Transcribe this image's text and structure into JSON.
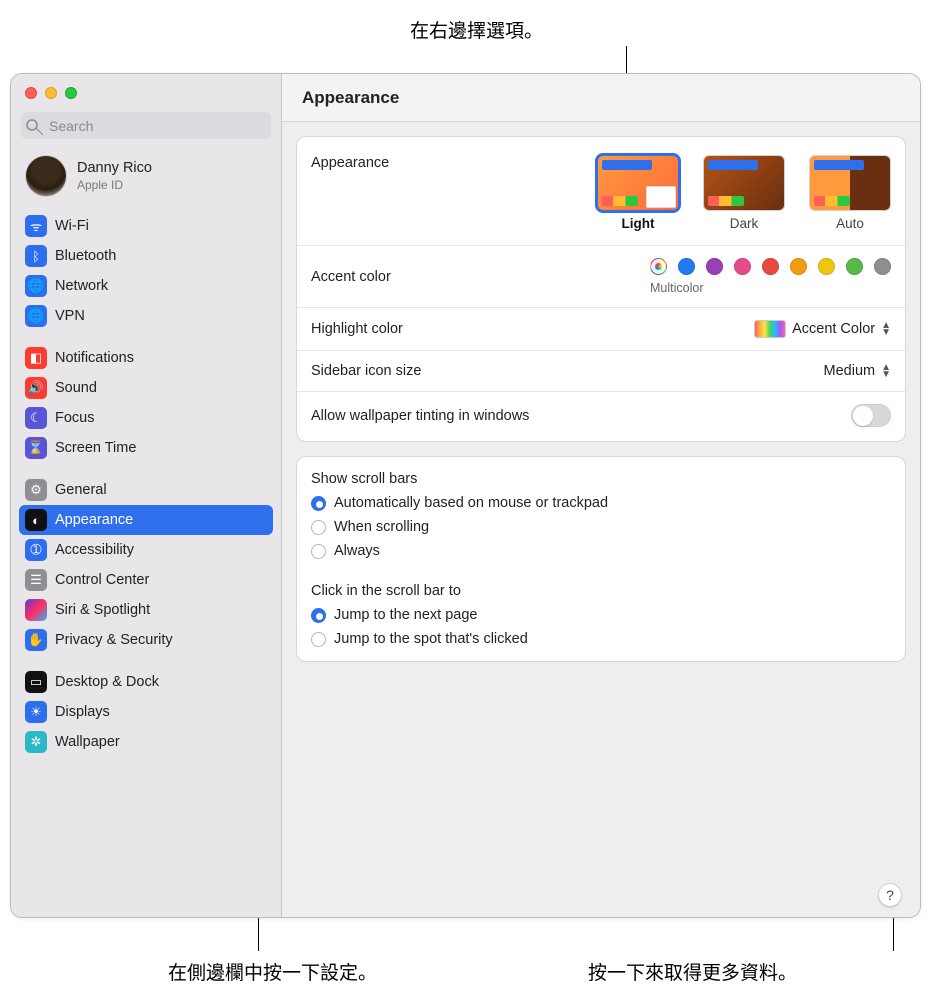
{
  "callouts": {
    "top": "在右邊擇選項。",
    "bottom_left": "在側邊欄中按一下設定。",
    "bottom_right": "按一下來取得更多資料。"
  },
  "window": {
    "title": "Appearance"
  },
  "search": {
    "placeholder": "Search"
  },
  "user": {
    "name": "Danny Rico",
    "sub": "Apple ID"
  },
  "sidebar": {
    "groups": [
      {
        "items": [
          {
            "id": "wifi",
            "label": "Wi-Fi",
            "icon": "ic-wifi",
            "glyph": "ᯤ"
          },
          {
            "id": "bluetooth",
            "label": "Bluetooth",
            "icon": "ic-bt",
            "glyph": "ᛒ"
          },
          {
            "id": "network",
            "label": "Network",
            "icon": "ic-net",
            "glyph": "🌐"
          },
          {
            "id": "vpn",
            "label": "VPN",
            "icon": "ic-vpn",
            "glyph": "🌐"
          }
        ]
      },
      {
        "items": [
          {
            "id": "notifications",
            "label": "Notifications",
            "icon": "ic-notif",
            "glyph": "◧"
          },
          {
            "id": "sound",
            "label": "Sound",
            "icon": "ic-sound",
            "glyph": "🔊"
          },
          {
            "id": "focus",
            "label": "Focus",
            "icon": "ic-focus",
            "glyph": "☾"
          },
          {
            "id": "screentime",
            "label": "Screen Time",
            "icon": "ic-st",
            "glyph": "⌛"
          }
        ]
      },
      {
        "items": [
          {
            "id": "general",
            "label": "General",
            "icon": "ic-gen",
            "glyph": "⚙"
          },
          {
            "id": "appearance",
            "label": "Appearance",
            "icon": "ic-app",
            "glyph": "◐",
            "selected": true
          },
          {
            "id": "accessibility",
            "label": "Accessibility",
            "icon": "ic-access",
            "glyph": "➀"
          },
          {
            "id": "controlcenter",
            "label": "Control Center",
            "icon": "ic-cc",
            "glyph": "☰"
          },
          {
            "id": "siri",
            "label": "Siri & Spotlight",
            "icon": "ic-siri",
            "glyph": ""
          },
          {
            "id": "privacy",
            "label": "Privacy & Security",
            "icon": "ic-priv",
            "glyph": "✋"
          }
        ]
      },
      {
        "items": [
          {
            "id": "desktopdock",
            "label": "Desktop & Dock",
            "icon": "ic-dd",
            "glyph": "▭"
          },
          {
            "id": "displays",
            "label": "Displays",
            "icon": "ic-disp",
            "glyph": "☀"
          },
          {
            "id": "wallpaper",
            "label": "Wallpaper",
            "icon": "ic-wall",
            "glyph": "✲"
          }
        ]
      }
    ]
  },
  "pane": {
    "appearance": {
      "label": "Appearance",
      "options": [
        {
          "label": "Light",
          "selected": true,
          "mode": "light"
        },
        {
          "label": "Dark",
          "selected": false,
          "mode": "dark"
        },
        {
          "label": "Auto",
          "selected": false,
          "mode": "auto"
        }
      ]
    },
    "accent": {
      "label": "Accent color",
      "sub": "Multicolor",
      "colors": [
        {
          "name": "multicolor",
          "hex": "conic",
          "selected": true
        },
        {
          "name": "blue",
          "hex": "#1e7bf0"
        },
        {
          "name": "purple",
          "hex": "#9a3fb8"
        },
        {
          "name": "pink",
          "hex": "#e84b8a"
        },
        {
          "name": "red",
          "hex": "#e74b3c"
        },
        {
          "name": "orange",
          "hex": "#f39c12"
        },
        {
          "name": "yellow",
          "hex": "#f1c40f"
        },
        {
          "name": "green",
          "hex": "#58b947"
        },
        {
          "name": "graphite",
          "hex": "#8e8e93"
        }
      ]
    },
    "highlight": {
      "label": "Highlight color",
      "value": "Accent Color"
    },
    "sidebar_size": {
      "label": "Sidebar icon size",
      "value": "Medium"
    },
    "tinting": {
      "label": "Allow wallpaper tinting in windows",
      "on": false
    },
    "scrollbars": {
      "label": "Show scroll bars",
      "options": [
        {
          "label": "Automatically based on mouse or trackpad",
          "checked": true
        },
        {
          "label": "When scrolling",
          "checked": false
        },
        {
          "label": "Always",
          "checked": false
        }
      ]
    },
    "click_scroll": {
      "label": "Click in the scroll bar to",
      "options": [
        {
          "label": "Jump to the next page",
          "checked": true
        },
        {
          "label": "Jump to the spot that's clicked",
          "checked": false
        }
      ]
    }
  },
  "help_glyph": "?"
}
